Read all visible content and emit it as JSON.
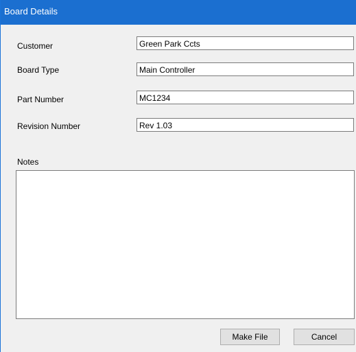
{
  "window": {
    "title": "Board Details"
  },
  "form": {
    "customer": {
      "label": "Customer",
      "value": "Green Park Ccts"
    },
    "board_type": {
      "label": "Board Type",
      "value": "Main Controller"
    },
    "part_number": {
      "label": "Part Number",
      "value": "MC1234"
    },
    "revision_number": {
      "label": "Revision Number",
      "value": "Rev 1.03"
    },
    "notes": {
      "label": "Notes",
      "value": ""
    }
  },
  "buttons": {
    "make_file": "Make File",
    "cancel": "Cancel"
  },
  "colors": {
    "title_bar": "#1b6fd0",
    "dialog_background": "#f0f0f0",
    "field_border": "#7a7a7a",
    "button_face": "#e1e1e1"
  }
}
